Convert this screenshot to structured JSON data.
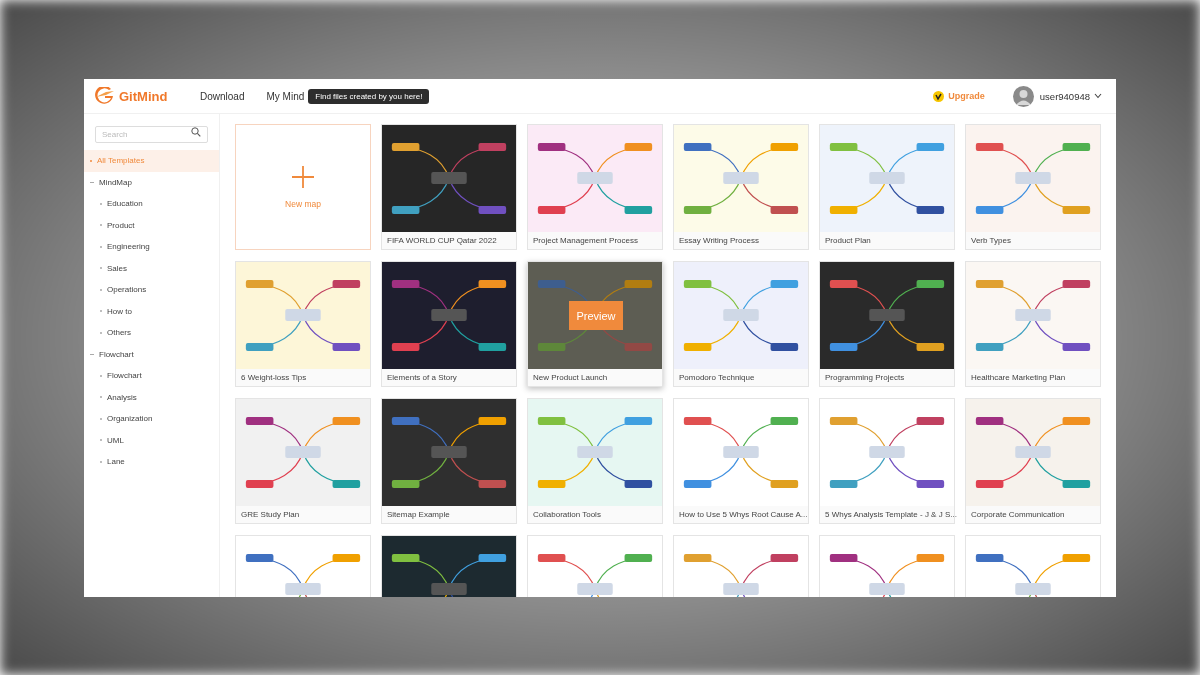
{
  "brand": "GitMind",
  "nav": [
    {
      "label": "Download"
    },
    {
      "label": "My Mind"
    }
  ],
  "tooltip": "Find files created by you here!",
  "upgrade": "Upgrade",
  "user": {
    "name": "user940948"
  },
  "sidebar": {
    "search": {
      "placeholder": "Search"
    },
    "items": [
      {
        "label": "All Templates",
        "selected": true
      },
      {
        "label": "MindMap",
        "selected": false,
        "expanded": true,
        "children": [
          {
            "label": "Education",
            "selected": false
          },
          {
            "label": "Product",
            "selected": false
          },
          {
            "label": "Engineering",
            "selected": false
          },
          {
            "label": "Sales",
            "selected": false
          },
          {
            "label": "Operations",
            "selected": false
          },
          {
            "label": "How to",
            "selected": false
          },
          {
            "label": "Others",
            "selected": false
          }
        ]
      },
      {
        "label": "Flowchart",
        "selected": false,
        "expanded": true,
        "children": [
          {
            "label": "Flowchart",
            "selected": false
          },
          {
            "label": "Analysis",
            "selected": false
          },
          {
            "label": "Organization",
            "selected": false
          },
          {
            "label": "UML",
            "selected": false
          },
          {
            "label": "Lane",
            "selected": false
          }
        ]
      }
    ]
  },
  "new_map": "New map",
  "templates": [
    {
      "title": "FIFA WORLD CUP Qatar 2022",
      "hovered": false
    },
    {
      "title": "Project Management Process",
      "hovered": false
    },
    {
      "title": "Essay Writing Process",
      "hovered": false
    },
    {
      "title": "Product Plan",
      "hovered": false
    },
    {
      "title": "Verb Types",
      "hovered": false
    },
    {
      "title": "6 Weight-loss Tips",
      "hovered": false
    },
    {
      "title": "Elements of a Story",
      "hovered": false
    },
    {
      "title": "New Product Launch",
      "hovered": true,
      "preview": "Preview"
    },
    {
      "title": "Pomodoro Technique",
      "hovered": false
    },
    {
      "title": "Programming Projects",
      "hovered": false
    },
    {
      "title": "Healthcare Marketing Plan",
      "hovered": false
    },
    {
      "title": "GRE Study Plan",
      "hovered": false
    },
    {
      "title": "Sitemap Example",
      "hovered": false
    },
    {
      "title": "Collaboration Tools",
      "hovered": false
    },
    {
      "title": "How to Use 5 Whys Root Cause A...",
      "hovered": false
    },
    {
      "title": "5 Whys Analysis Template - J & J S...",
      "hovered": false
    },
    {
      "title": "Corporate Communication",
      "hovered": false
    },
    {
      "hovered": false
    },
    {
      "hovered": false
    },
    {
      "hovered": false
    },
    {
      "hovered": false
    },
    {
      "hovered": false
    },
    {
      "hovered": false
    }
  ]
}
